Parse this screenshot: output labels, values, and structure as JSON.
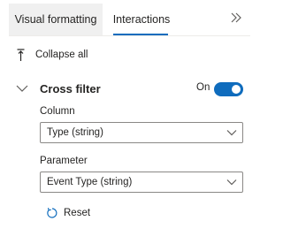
{
  "tabs": [
    {
      "label": "Visual formatting",
      "active": false
    },
    {
      "label": "Interactions",
      "active": true
    }
  ],
  "expand_icon": "double-chevron-right-icon",
  "collapse_all": {
    "label": "Collapse all",
    "icon": "collapse-all-icon"
  },
  "cross_filter": {
    "title": "Cross filter",
    "toggle_label": "On",
    "toggle_on": true,
    "column": {
      "label": "Column",
      "value": "Type (string)"
    },
    "parameter": {
      "label": "Parameter",
      "value": "Event Type (string)"
    },
    "reset": {
      "label": "Reset",
      "icon": "reset-icon"
    }
  },
  "colors": {
    "accent": "#0f6cbd",
    "text": "#252423",
    "border": "#8a8886",
    "tab_bg": "#f0f0f0"
  }
}
